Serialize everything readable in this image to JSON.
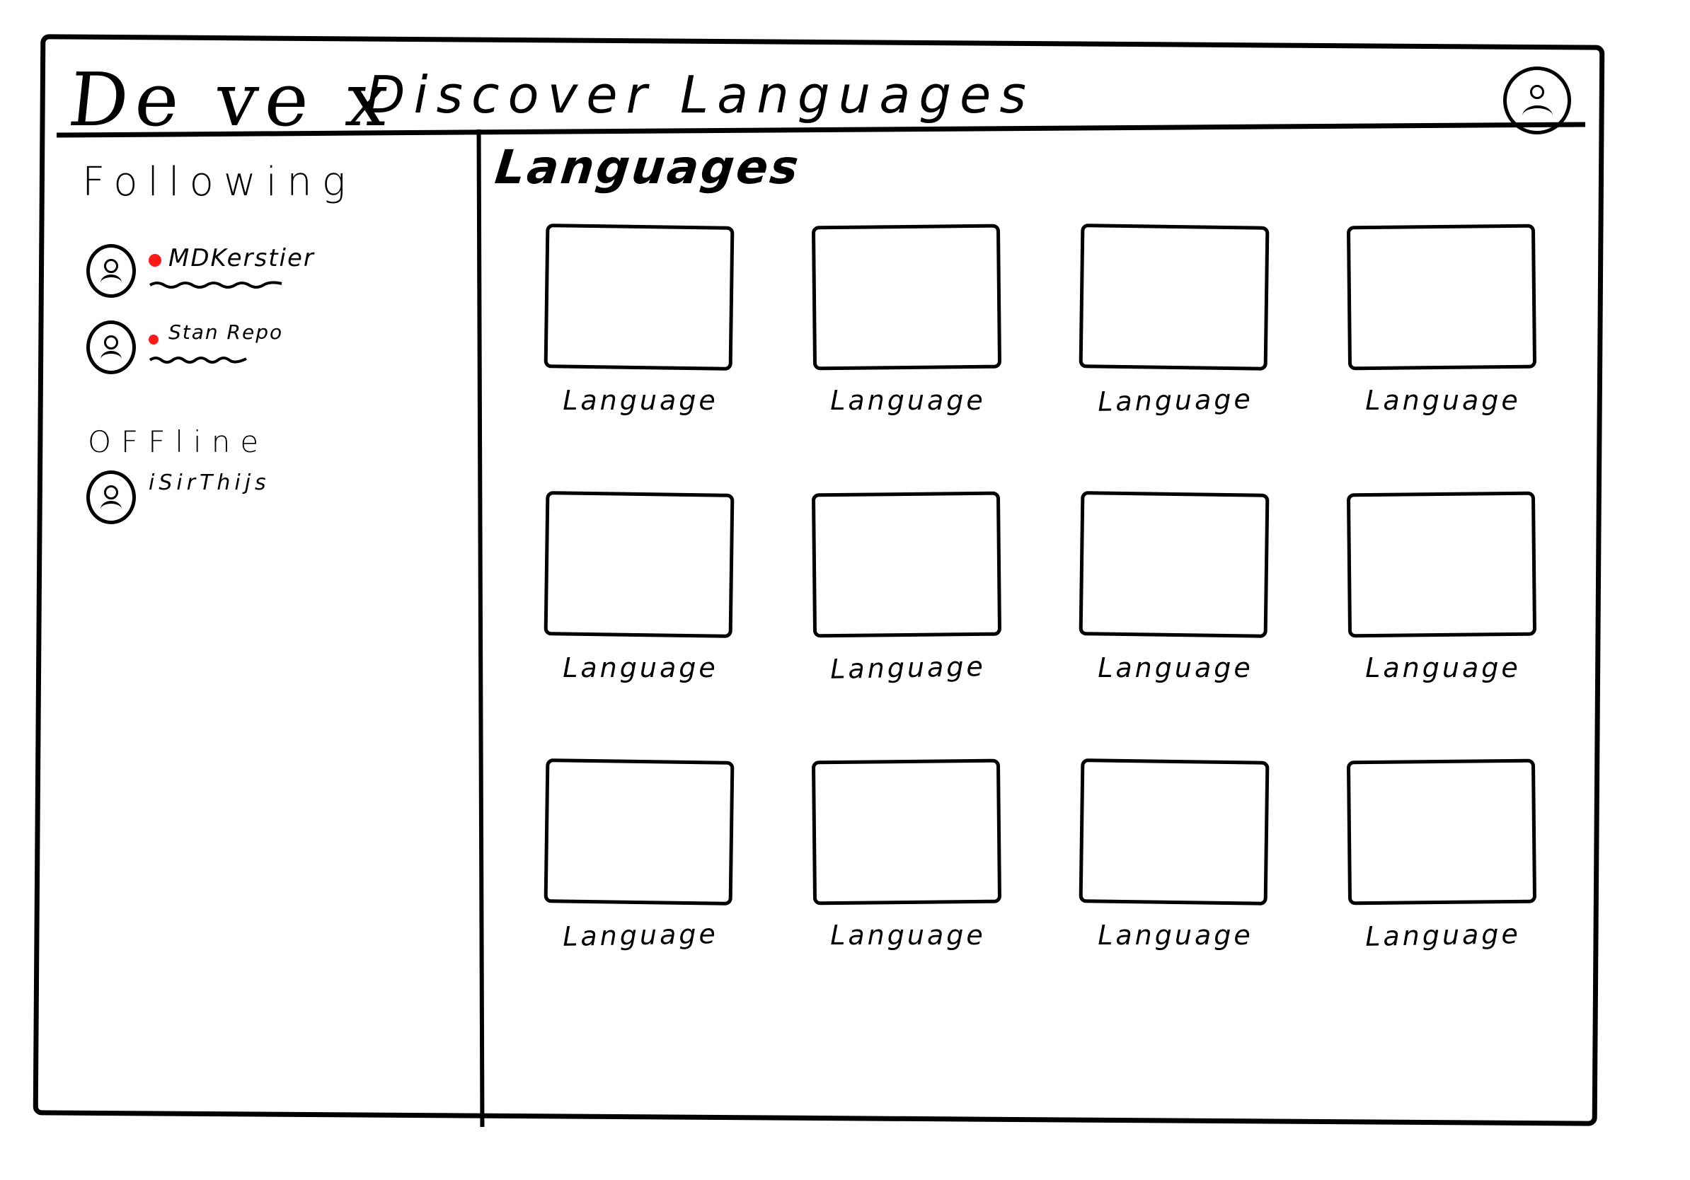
{
  "header": {
    "logo": "De ve x",
    "title": "Discover Languages",
    "profile_icon": "avatar-face-icon"
  },
  "sidebar": {
    "following_heading": "Following",
    "following": [
      {
        "name": "MDKerstier",
        "status": "online",
        "status_color": "#ff1a1a"
      },
      {
        "name": "Stan Repo",
        "status": "online",
        "status_color": "#ff1a1a"
      }
    ],
    "offline_heading": "OFFline",
    "offline": [
      {
        "name": "iSirThijs"
      }
    ]
  },
  "main": {
    "heading": "Languages",
    "cards": [
      {
        "label": "Language"
      },
      {
        "label": "Language"
      },
      {
        "label": "Language"
      },
      {
        "label": "Language"
      },
      {
        "label": "Language"
      },
      {
        "label": "Language"
      },
      {
        "label": "Language"
      },
      {
        "label": "Language"
      },
      {
        "label": "Language"
      },
      {
        "label": "Language"
      },
      {
        "label": "Language"
      },
      {
        "label": "Language"
      }
    ]
  }
}
